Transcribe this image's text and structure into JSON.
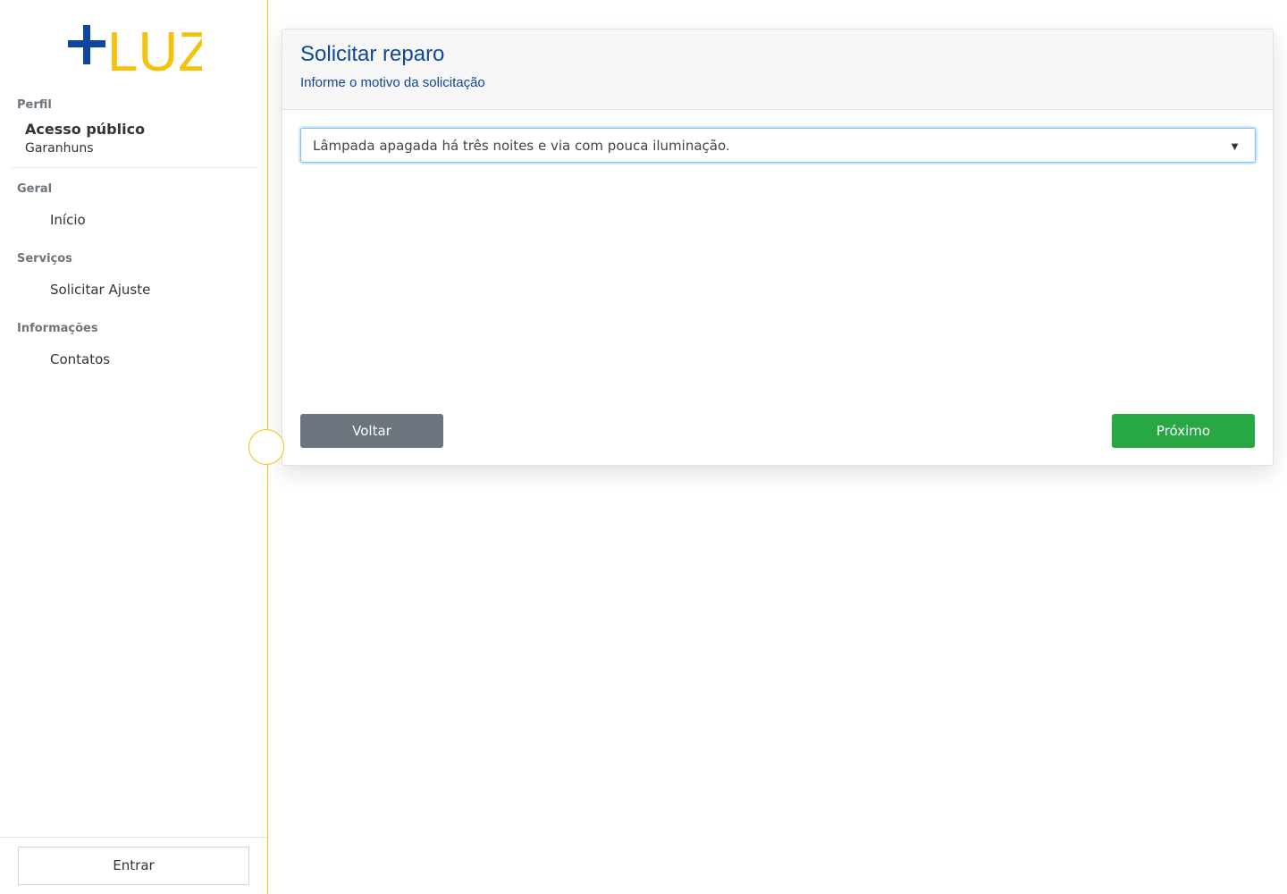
{
  "brand": {
    "logo_text": "+LUZ",
    "plus_color": "#0d47a1",
    "text_color": "#f4c20d"
  },
  "sidebar": {
    "profile": {
      "section_label": "Perfil",
      "name": "Acesso público",
      "city": "Garanhuns"
    },
    "sections": [
      {
        "label": "Geral",
        "items": [
          {
            "label": "Início"
          }
        ]
      },
      {
        "label": "Serviços",
        "items": [
          {
            "label": "Solicitar Ajuste"
          }
        ]
      },
      {
        "label": "Informações",
        "items": [
          {
            "label": "Contatos"
          }
        ]
      }
    ],
    "login_label": "Entrar",
    "accent_color": "#f4c20d"
  },
  "card": {
    "title": "Solicitar reparo",
    "subtitle": "Informe o motivo da solicitação",
    "reason_select": {
      "selected_value": "Lâmpada apagada há três noites e via com pouca iluminação.",
      "caret_icon": "▼"
    },
    "back_label": "Voltar",
    "next_label": "Próximo",
    "colors": {
      "title": "#0d47a1",
      "back_button": "#6c757d",
      "next_button": "#28a745"
    }
  }
}
